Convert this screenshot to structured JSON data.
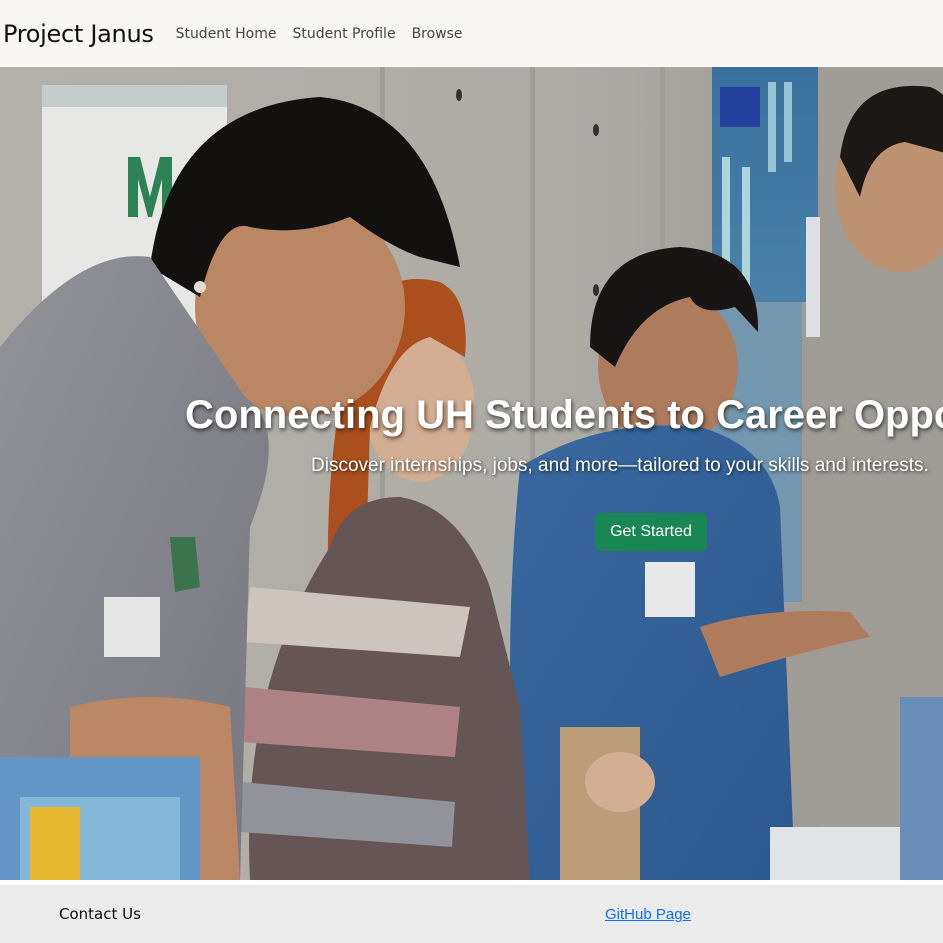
{
  "navbar": {
    "brand": "Project Janus",
    "links": [
      "Student Home",
      "Student Profile",
      "Browse"
    ]
  },
  "hero": {
    "title": "Connecting UH Students to Career Opportunities",
    "subtitle": "Discover internships, jobs, and more—tailored to your skills and interests.",
    "cta_label": "Get Started",
    "image_description_icon": "career-fair-photo",
    "cta_color": "#198754"
  },
  "footer": {
    "contact_label": "Contact Us",
    "github_label": "GitHub Page",
    "link_color": "#0d6efd"
  }
}
